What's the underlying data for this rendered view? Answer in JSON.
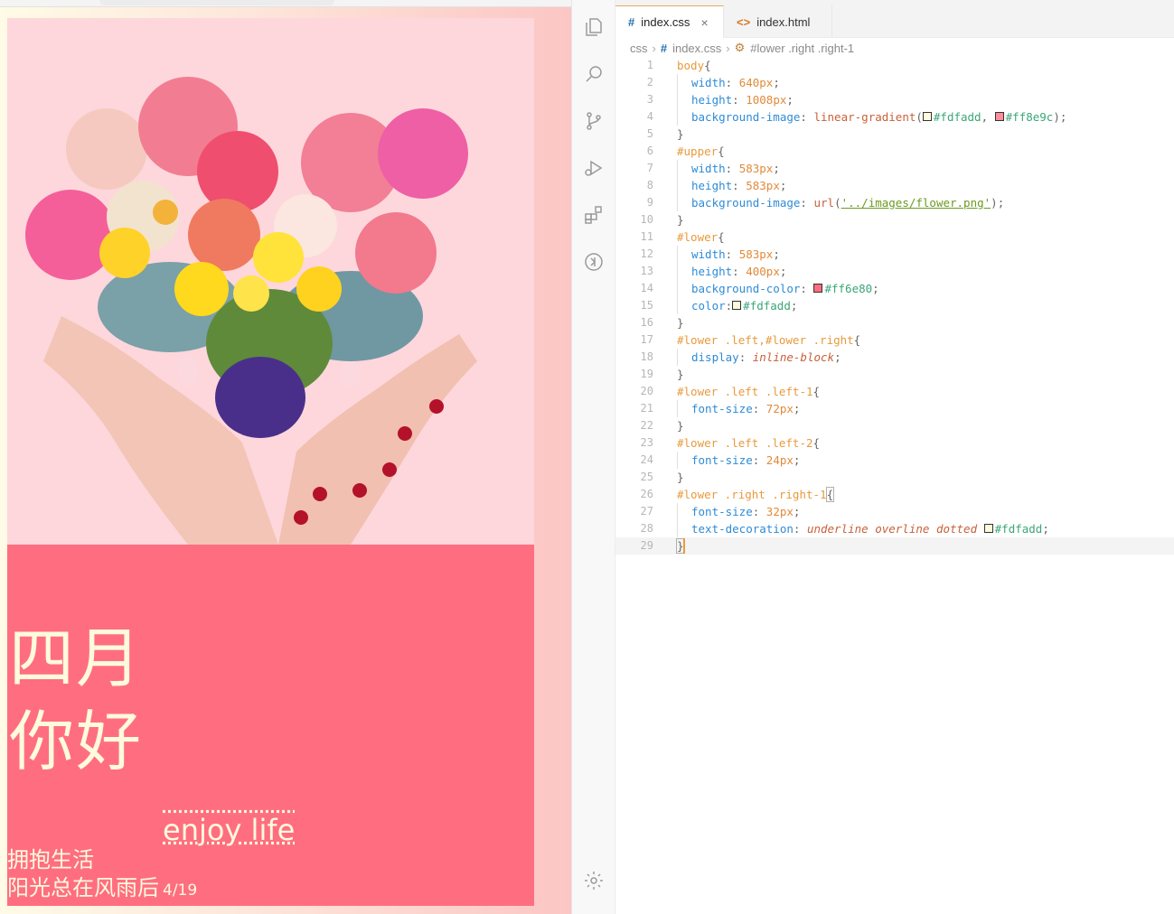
{
  "preview": {
    "lower": {
      "left1_line1": "四月",
      "left1_line2": "你好",
      "left2_line1": "拥抱生活",
      "left2_line2": "阳光总在风雨后",
      "date": "4/19",
      "right1": "enjoy life"
    }
  },
  "editor": {
    "tabs": [
      {
        "glyph": "#",
        "label": "index.css",
        "close": "×"
      },
      {
        "glyph": "<>",
        "label": "index.html"
      }
    ],
    "breadcrumb": {
      "folder": "css",
      "file": "index.css",
      "symbol": "#lower .right .right-1"
    },
    "line_numbers": [
      "1",
      "2",
      "3",
      "4",
      "5",
      "6",
      "7",
      "8",
      "9",
      "10",
      "11",
      "12",
      "13",
      "14",
      "15",
      "16",
      "17",
      "18",
      "19",
      "20",
      "21",
      "22",
      "23",
      "24",
      "25",
      "26",
      "27",
      "28",
      "29"
    ],
    "code": {
      "l1_sel": "body",
      "l2_prop": "width",
      "l2_val": "640px",
      "l3_prop": "height",
      "l3_val": "1008px",
      "l4_prop": "background-image",
      "l4_fn": "linear-gradient",
      "l4_c1": "#fdfadd",
      "l4_c2": "#ff8e9c",
      "l6_sel": "#upper",
      "l7_prop": "width",
      "l7_val": "583px",
      "l8_prop": "height",
      "l8_val": "583px",
      "l9_prop": "background-image",
      "l9_fn": "url",
      "l9_str": "'../images/flower.png'",
      "l11_sel": "#lower",
      "l12_prop": "width",
      "l12_val": "583px",
      "l13_prop": "height",
      "l13_val": "400px",
      "l14_prop": "background-color",
      "l14_c": "#ff6e80",
      "l15_prop": "color",
      "l15_c": "#fdfadd",
      "l17_sel": "#lower .left,#lower .right",
      "l18_prop": "display",
      "l18_val": "inline-block",
      "l20_sel": "#lower .left .left-1",
      "l21_prop": "font-size",
      "l21_val": "72px",
      "l23_sel": "#lower .left .left-2",
      "l24_prop": "font-size",
      "l24_val": "24px",
      "l26_sel": "#lower .right .right-1",
      "l27_prop": "font-size",
      "l27_val": "32px",
      "l28_prop": "text-decoration",
      "l28_val": "underline overline dotted",
      "l28_c": "#fdfadd"
    }
  },
  "colors": {
    "swatch_fdfadd": "#fdfadd",
    "swatch_ff8e9c": "#ff8e9c",
    "swatch_ff6e80": "#ff6e80",
    "accent": "#e89a3c"
  },
  "icons": [
    "explorer-icon",
    "search-icon",
    "source-control-icon",
    "run-debug-icon",
    "extensions-icon",
    "remote-icon",
    "settings-gear-icon"
  ]
}
